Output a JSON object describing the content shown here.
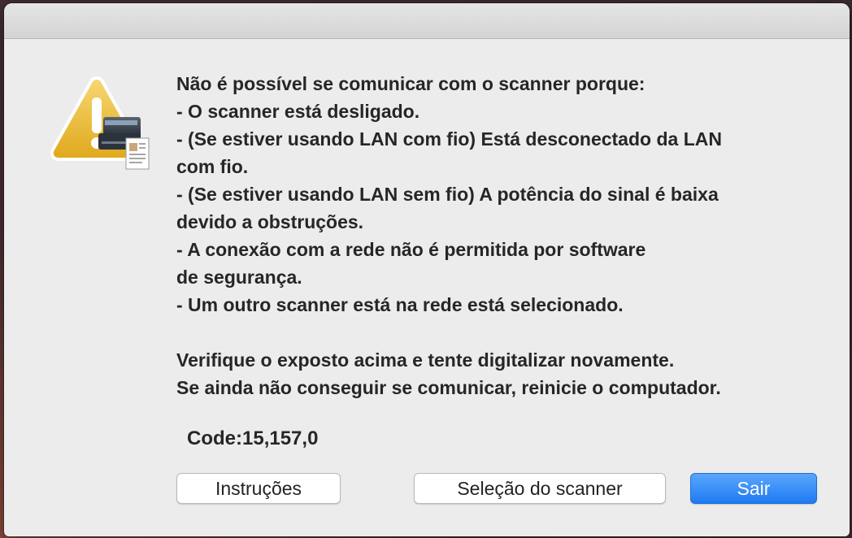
{
  "dialog": {
    "message_lines": [
      "Não é possível se comunicar com o scanner porque:",
      "- O scanner está desligado.",
      "- (Se estiver usando LAN com fio) Está desconectado da LAN",
      "com fio.",
      "- (Se estiver usando LAN sem fio) A potência do sinal é baixa",
      "devido a obstruções.",
      "- A conexão com a rede não é permitida por software",
      "de segurança.",
      "- Um outro scanner está na rede está selecionado."
    ],
    "advice_lines": [
      "Verifique o exposto acima e tente digitalizar novamente.",
      "Se ainda não conseguir se comunicar, reinicie o computador."
    ],
    "code": "Code:15,157,0",
    "icon": "warning-scanner-icon"
  },
  "buttons": {
    "instructions_label": "Instruções",
    "scanner_selection_label": "Seleção do scanner",
    "exit_label": "Sair"
  },
  "colors": {
    "accent": "#1f7bf2",
    "warning_yellow": "#f1c232",
    "dialog_bg": "#ececec"
  }
}
